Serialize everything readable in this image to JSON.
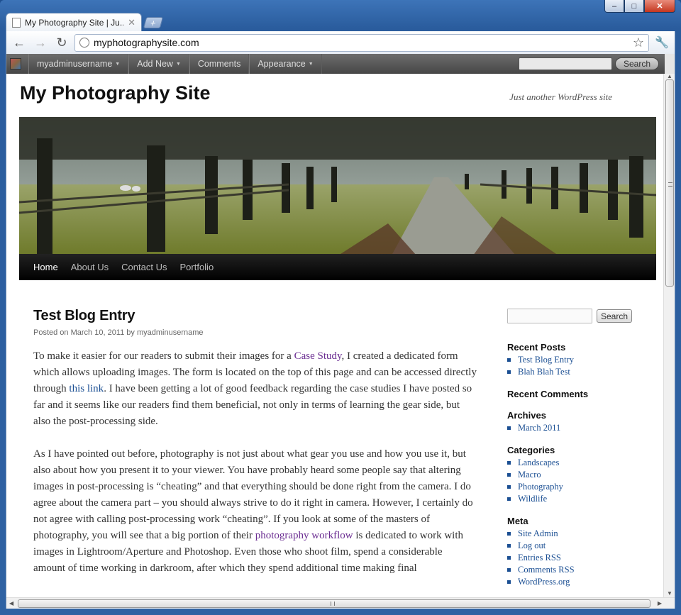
{
  "browser": {
    "tab_title": "My Photography Site | Ju...",
    "new_tab_label": "+",
    "url": "myphotographysite.com"
  },
  "admin_bar": {
    "username": "myadminusername",
    "add_new": "Add New",
    "comments": "Comments",
    "appearance": "Appearance",
    "search_button": "Search"
  },
  "site": {
    "title": "My Photography Site",
    "tagline": "Just another WordPress site"
  },
  "nav": {
    "items": [
      "Home",
      "About Us",
      "Contact Us",
      "Portfolio"
    ]
  },
  "post": {
    "title": "Test Blog Entry",
    "posted_on": "Posted on",
    "date": "March 10, 2011",
    "by": "by",
    "author": "myadminusername",
    "p1_a": "To make it easier for our readers to submit their images for a ",
    "p1_link1": "Case Study",
    "p1_b": ", I created a dedicated form which allows uploading images. The form is located on the top of this page and can be accessed directly through ",
    "p1_link2": "this link",
    "p1_c": ". I have been getting a lot of good feedback regarding the case studies I have posted so far and it seems like our readers find them beneficial, not only in terms of learning the gear side, but also the post-processing side.",
    "p2_a": "As I have pointed out before, photography is not just about what gear you use and how you use it, but also about how you present it to your viewer. You have probably heard some people say that altering images in post-processing is “cheating” and that everything should be done right from the camera. I do agree about the camera part – you should always strive to do it right in camera. However, I certainly do not agree with calling post-processing work “cheating”. If you look at some of the masters of photography, you will see that a big portion of their ",
    "p2_link": "photography workflow",
    "p2_b": " is dedicated to work with images in Lightroom/Aperture and Photoshop. Even those who shoot film, spend a considerable amount of time working in darkroom, after which they spend additional time making final"
  },
  "sidebar": {
    "search_button": "Search",
    "recent_posts": {
      "title": "Recent Posts",
      "items": [
        "Test Blog Entry",
        "Blah Blah Test"
      ]
    },
    "recent_comments": {
      "title": "Recent Comments"
    },
    "archives": {
      "title": "Archives",
      "items": [
        "March 2011"
      ]
    },
    "categories": {
      "title": "Categories",
      "items": [
        "Landscapes",
        "Macro",
        "Photography",
        "Wildlife"
      ]
    },
    "meta": {
      "title": "Meta",
      "items": [
        "Site Admin",
        "Log out",
        "Entries RSS",
        "Comments RSS",
        "WordPress.org"
      ]
    }
  }
}
